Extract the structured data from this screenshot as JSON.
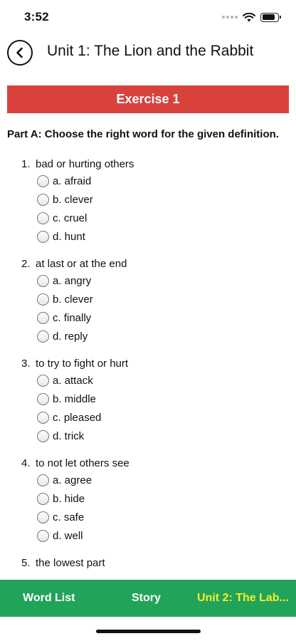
{
  "status_bar": {
    "time": "3:52",
    "icons": [
      "signal-icon",
      "wifi-icon",
      "battery-icon"
    ],
    "battery_level": 0.85
  },
  "header": {
    "back_icon": "chevron-left-icon",
    "title": "Unit 1: The Lion and the Rabbit"
  },
  "exercise": {
    "title": "Exercise 1",
    "color": "#d9413c"
  },
  "part_a": {
    "title": "Part A: Choose the right word for the given definition.",
    "questions": [
      {
        "number": "1.",
        "text": "bad or hurting others",
        "options": [
          "a. afraid",
          "b. clever",
          "c. cruel",
          "d. hunt"
        ]
      },
      {
        "number": "2.",
        "text": "at last or at the end",
        "options": [
          "a. angry",
          "b. clever",
          "c. finally",
          "d. reply"
        ]
      },
      {
        "number": "3.",
        "text": "to try to fight or hurt",
        "options": [
          "a. attack",
          "b. middle",
          "c. pleased",
          "d. trick"
        ]
      },
      {
        "number": "4.",
        "text": "to not let others see",
        "options": [
          "a. agree",
          "b. hide",
          "c. safe",
          "d. well"
        ]
      },
      {
        "number": "5.",
        "text": "the lowest part",
        "options": []
      }
    ]
  },
  "bottom_bar": {
    "color": "#22a35a",
    "tabs": {
      "word_list": "Word List",
      "story": "Story",
      "next_unit": "Unit 2: The Lab..."
    },
    "next_unit_color": "#f5ee2a"
  }
}
